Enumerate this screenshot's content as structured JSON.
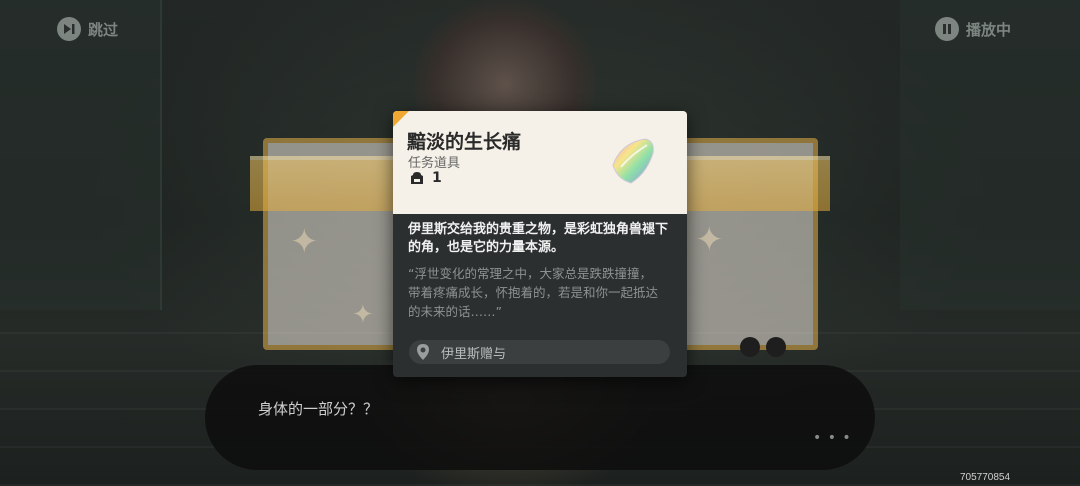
{
  "top_bar": {
    "skip_label": "跳过",
    "playing_label": "播放中"
  },
  "item_card": {
    "name": "黯淡的生长痛",
    "type": "任务道具",
    "count": "1",
    "description": "伊里斯交给我的贵重之物，是彩虹独角兽褪下的角，也是它的力量本源。",
    "quote_line1": "“浮世变化的常理之中，大家总是跌跌撞撞，",
    "quote_line2": "带着疼痛成长，怀抱着的，若是和你一起抵达",
    "quote_line3": "的未来的话……”",
    "source": "伊里斯赠与"
  },
  "dialogue": {
    "text": "身体的一部分？？",
    "more": "• • •"
  },
  "watermark": "705770854"
}
